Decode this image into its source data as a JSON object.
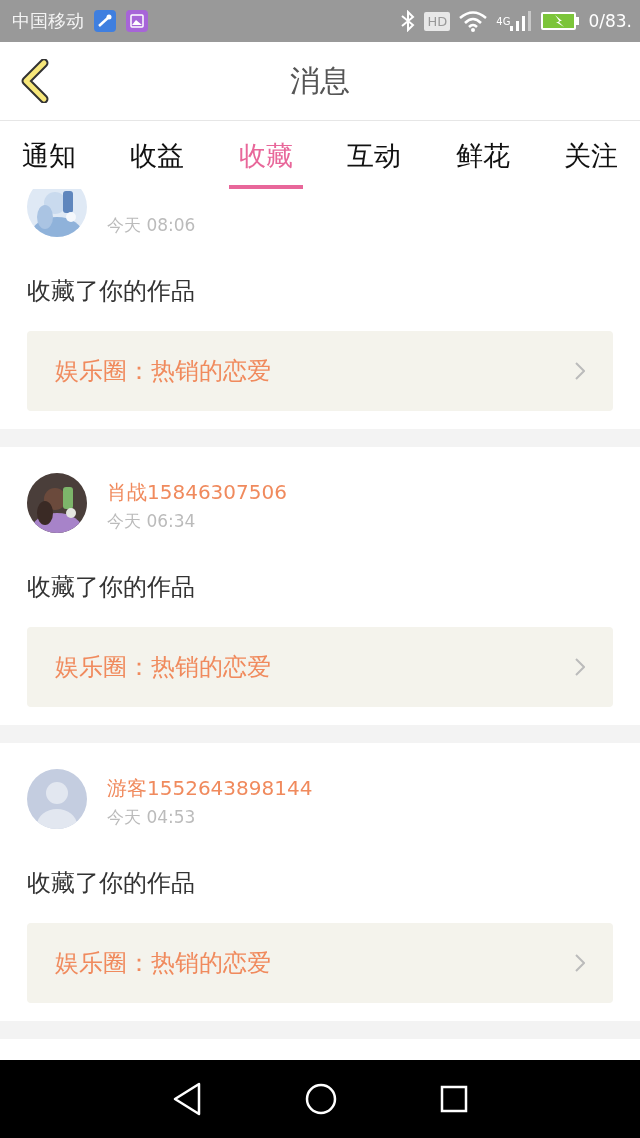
{
  "status_bar": {
    "carrier": "中国移动",
    "hd": "HD",
    "network": "4G",
    "battery": "0/83."
  },
  "header": {
    "title": "消息"
  },
  "tabs": [
    {
      "label": "通知",
      "selected": false
    },
    {
      "label": "收益",
      "selected": false
    },
    {
      "label": "收藏",
      "selected": true
    },
    {
      "label": "互动",
      "selected": false
    },
    {
      "label": "鲜花",
      "selected": false
    },
    {
      "label": "关注",
      "selected": false
    }
  ],
  "messages": [
    {
      "kind": "picture",
      "time": "今天 08:06",
      "action": "收藏了你的作品",
      "link": "娱乐圈：热销的恋爱"
    },
    {
      "name": "肖战15846307506",
      "kind": "picture",
      "time": "今天 06:34",
      "action": "收藏了你的作品",
      "link": "娱乐圈：热销的恋爱"
    },
    {
      "name": "游客1552643898144",
      "kind": "default",
      "time": "今天 04:53",
      "action": "收藏了你的作品",
      "link": "娱乐圈：热销的恋爱"
    }
  ]
}
